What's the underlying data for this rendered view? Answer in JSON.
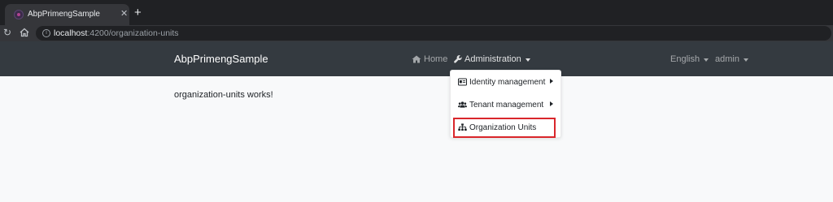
{
  "browser": {
    "tab": {
      "title": "AbpPrimengSample",
      "close": "✕"
    },
    "new_tab": "+",
    "url": {
      "host": "localhost",
      "path": ":4200/organization-units"
    }
  },
  "navbar": {
    "brand": "AbpPrimengSample",
    "home": "Home",
    "administration": "Administration",
    "language": "English",
    "user": "admin"
  },
  "page": {
    "content": "organization-units works!"
  },
  "dropdown": {
    "items": [
      {
        "label": "Identity management",
        "icon": "id-card-icon",
        "has_submenu": true
      },
      {
        "label": "Tenant management",
        "icon": "users-icon",
        "has_submenu": true
      },
      {
        "label": "Organization Units",
        "icon": "sitemap-icon",
        "has_submenu": false,
        "highlighted": true
      }
    ]
  },
  "colors": {
    "navbar": "#343a40",
    "highlight": "#d9262b",
    "page": "#f8f9fa"
  }
}
